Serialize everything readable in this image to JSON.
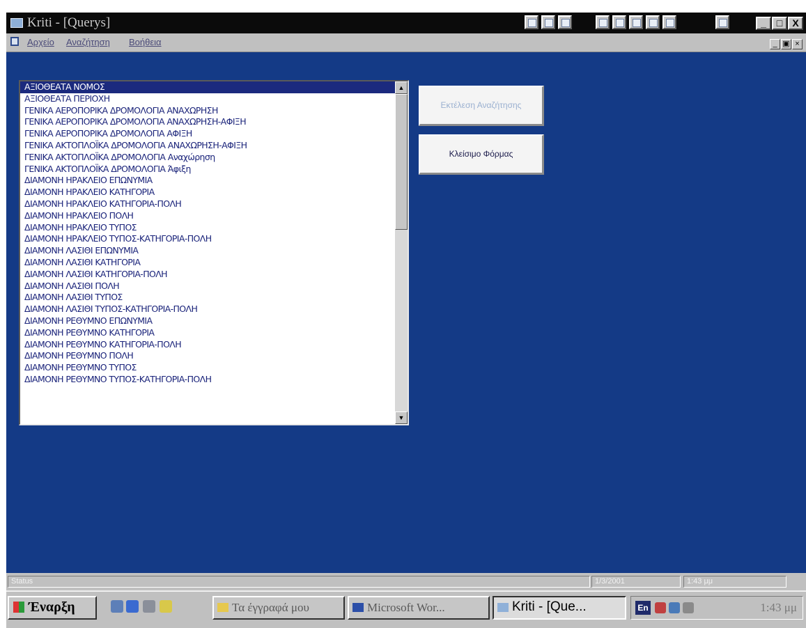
{
  "window": {
    "title": "Kriti - [Querys]",
    "minimize_glyph": "_",
    "maximize_glyph": "□",
    "close_glyph": "X"
  },
  "menu": {
    "items": [
      "Αρχείο",
      "Αναζήτηση",
      "Βοήθεια"
    ],
    "doc_minimize_glyph": "_",
    "doc_restore_glyph": "▣",
    "doc_close_glyph": "×"
  },
  "list": {
    "selected_index": 0,
    "items": [
      "ΑΞΙΟΘΕΑΤΑ ΝΟΜΟΣ",
      "ΑΞΙΟΘΕΑΤΑ ΠΕΡΙΟΧΗ",
      "ΓΕΝΙΚΑ ΑΕΡΟΠΟΡΙΚΑ ΔΡΟΜΟΛΟΓΙΑ ΑΝΑΧΩΡΗΣΗ",
      "ΓΕΝΙΚΑ ΑΕΡΟΠΟΡΙΚΑ ΔΡΟΜΟΛΟΓΙΑ ΑΝΑΧΩΡΗΣΗ-ΑΦΙΞΗ",
      "ΓΕΝΙΚΑ ΑΕΡΟΠΟΡΙΚΑ ΔΡΟΜΟΛΟΓΙΑ ΑΦΙΞΗ",
      "ΓΕΝΙΚΑ ΑΚΤΟΠΛΟΪΚΑ ΔΡΟΜΟΛΟΓΙΑ ΑΝΑΧΩΡΗΣΗ-ΑΦΙΞΗ",
      "ΓΕΝΙΚΑ ΑΚΤΟΠΛΟΪΚΑ ΔΡΟΜΟΛΟΓΙΑ Αναχώρηση",
      "ΓΕΝΙΚΑ ΑΚΤΟΠΛΟΪΚΑ ΔΡΟΜΟΛΟΓΙΑ Άφιξη",
      "ΔΙΑΜΟΝΗ ΗΡΑΚΛΕΙΟ ΕΠΩΝΥΜΙΑ",
      "ΔΙΑΜΟΝΗ ΗΡΑΚΛΕΙΟ ΚΑΤΗΓΟΡΙΑ",
      "ΔΙΑΜΟΝΗ ΗΡΑΚΛΕΙΟ ΚΑΤΗΓΟΡΙΑ-ΠΟΛΗ",
      "ΔΙΑΜΟΝΗ ΗΡΑΚΛΕΙΟ ΠΟΛΗ",
      "ΔΙΑΜΟΝΗ ΗΡΑΚΛΕΙΟ ΤΥΠΟΣ",
      "ΔΙΑΜΟΝΗ ΗΡΑΚΛΕΙΟ ΤΥΠΟΣ-ΚΑΤΗΓΟΡΙΑ-ΠΟΛΗ",
      "ΔΙΑΜΟΝΗ ΛΑΣΙΘΙ ΕΠΩΝΥΜΙΑ",
      "ΔΙΑΜΟΝΗ ΛΑΣΙΘΙ ΚΑΤΗΓΟΡΙΑ",
      "ΔΙΑΜΟΝΗ ΛΑΣΙΘΙ ΚΑΤΗΓΟΡΙΑ-ΠΟΛΗ",
      "ΔΙΑΜΟΝΗ ΛΑΣΙΘΙ ΠΟΛΗ",
      "ΔΙΑΜΟΝΗ ΛΑΣΙΘΙ ΤΥΠΟΣ",
      "ΔΙΑΜΟΝΗ ΛΑΣΙΘΙ ΤΥΠΟΣ-ΚΑΤΗΓΟΡΙΑ-ΠΟΛΗ",
      "ΔΙΑΜΟΝΗ ΡΕΘΥΜΝΟ ΕΠΩΝΥΜΙΑ",
      "ΔΙΑΜΟΝΗ ΡΕΘΥΜΝΟ ΚΑΤΗΓΟΡΙΑ",
      "ΔΙΑΜΟΝΗ ΡΕΘΥΜΝΟ ΚΑΤΗΓΟΡΙΑ-ΠΟΛΗ",
      "ΔΙΑΜΟΝΗ ΡΕΘΥΜΝΟ ΠΟΛΗ",
      "ΔΙΑΜΟΝΗ ΡΕΘΥΜΝΟ ΤΥΠΟΣ",
      "ΔΙΑΜΟΝΗ ΡΕΘΥΜΝΟ ΤΥΠΟΣ-ΚΑΤΗΓΟΡΙΑ-ΠΟΛΗ"
    ],
    "scroll_up_glyph": "▲",
    "scroll_down_glyph": "▼"
  },
  "buttons": {
    "execute_search": "Εκτέλεση Αναζήτησης",
    "close_form": "Κλείσιμο Φόρμας"
  },
  "status": {
    "label": "Status",
    "date": "1/3/2001",
    "time": "1:43 μμ"
  },
  "taskbar": {
    "start_label": "Έναρξη",
    "tasks": [
      "Τα έγγραφά μου",
      "Microsoft Wor...",
      "Kriti - [Que..."
    ],
    "language": "En",
    "clock": "1:43 μμ"
  },
  "colors": {
    "client_background": "#143a86",
    "titlebar": "#0b0b0b",
    "selection": "#1b2a7e"
  }
}
